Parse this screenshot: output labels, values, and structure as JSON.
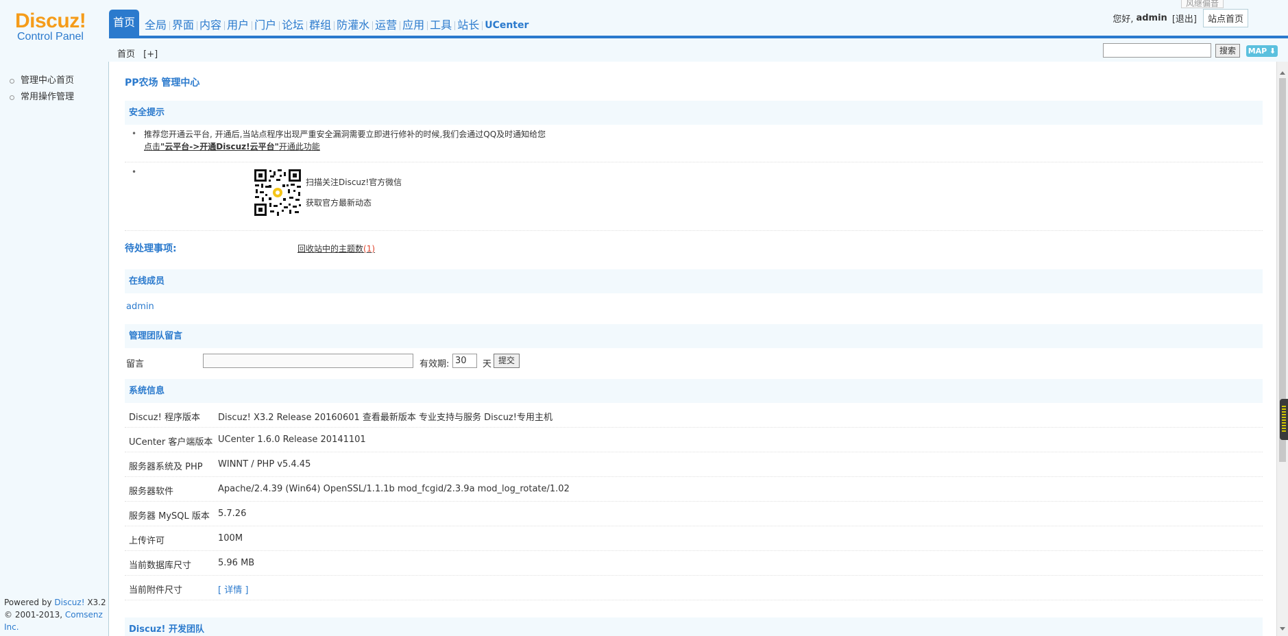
{
  "header": {
    "logo_brand": "Discuz!",
    "logo_sub": "Control Panel",
    "nav": [
      "首页",
      "全局",
      "界面",
      "内容",
      "用户",
      "门户",
      "论坛",
      "群组",
      "防灌水",
      "运营",
      "应用",
      "工具",
      "站长",
      "UCenter"
    ],
    "greeting": "您好,",
    "username": "admin",
    "logout_label": "退出",
    "site_home_label": "站点首页",
    "float_tip": "风继偏音"
  },
  "subbar": {
    "breadcrumb": "首页",
    "add_label": "[+]",
    "search_button": "搜索",
    "map_button": "MAP ⬇"
  },
  "sidebar": {
    "items": [
      "管理中心首页",
      "常用操作管理"
    ],
    "footer_line1_prefix": "Powered by ",
    "footer_line1_link": "Discuz!",
    "footer_line1_suffix": " X3.2",
    "footer_line2_prefix": "© 2001-2013, ",
    "footer_line2_link": "Comsenz Inc."
  },
  "main": {
    "title": "PP农场 管理中心",
    "security": {
      "heading": "安全提示",
      "line1": "推荐您开通云平台, 开通后,当站点程序出现严重安全漏洞需要立即进行修补的时候,我们会通过QQ及时通知给您",
      "link_prefix": "点击",
      "link_bold": "\"云平台->开通Discuz!云平台\"",
      "link_suffix": "开通此功能",
      "qr_text1": "扫描关注Discuz!官方微信",
      "qr_text2": "获取官方最新动态"
    },
    "pending": {
      "label": "待处理事项:",
      "link_text": "回收站中的主题数",
      "count_open": "(",
      "count": "1",
      "count_close": ")"
    },
    "online": {
      "heading": "在线成员",
      "user": "admin"
    },
    "message": {
      "heading": "管理团队留言",
      "label": "留言",
      "valid_label": "有效期:",
      "valid_value": "30",
      "day_label": "天",
      "submit_label": "提交"
    },
    "system": {
      "heading": "系统信息",
      "rows": [
        {
          "key": "Discuz! 程序版本",
          "value": "Discuz! X3.2 Release 20160601 查看最新版本 专业支持与服务 Discuz!专用主机"
        },
        {
          "key": "UCenter 客户端版本",
          "value": "UCenter 1.6.0 Release 20141101"
        },
        {
          "key": "服务器系统及 PHP",
          "value": "WINNT / PHP v5.4.45"
        },
        {
          "key": "服务器软件",
          "value": "Apache/2.4.39 (Win64) OpenSSL/1.1.1b mod_fcgid/2.3.9a mod_log_rotate/1.02"
        },
        {
          "key": "服务器 MySQL 版本",
          "value": "5.7.26"
        },
        {
          "key": "上传许可",
          "value": "100M"
        },
        {
          "key": "当前数据库尺寸",
          "value": "5.96 MB"
        },
        {
          "key": "当前附件尺寸",
          "value": "[ 详情 ]"
        }
      ]
    },
    "team": {
      "heading": "Discuz! 开发团队"
    }
  },
  "colors": {
    "accent": "#2b7acd",
    "logo_orange": "#f59c1a",
    "panel_bg": "#f2f9fd",
    "count_red": "#e0442c"
  }
}
